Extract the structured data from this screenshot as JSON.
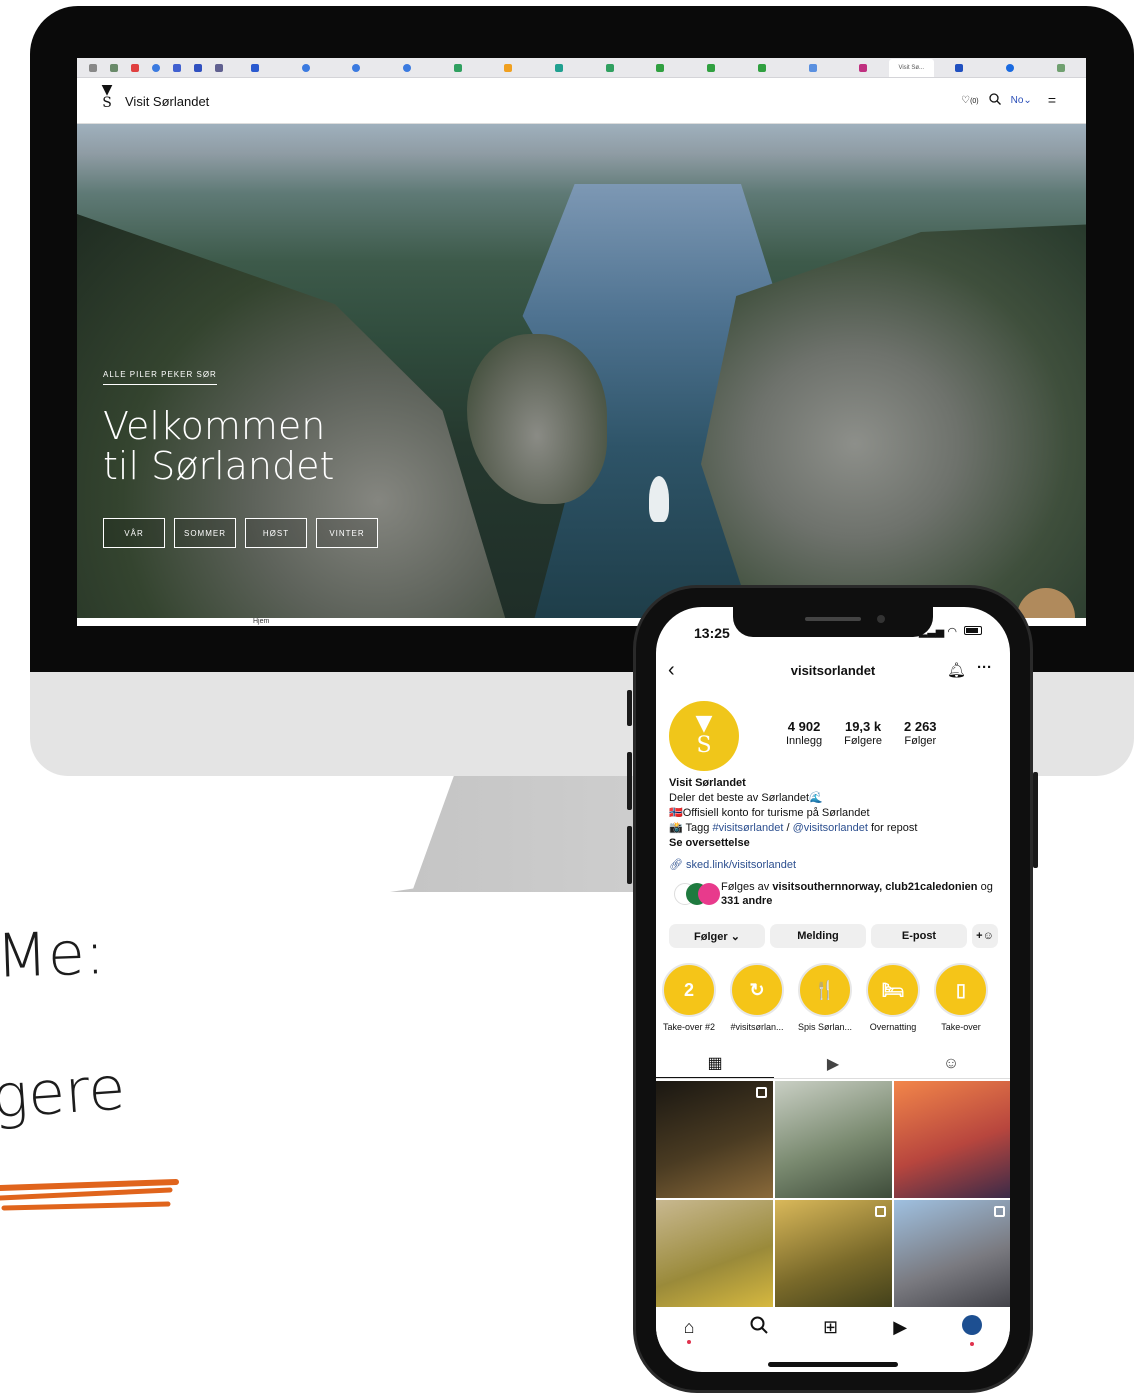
{
  "desktop": {
    "browser_tabs": {
      "active_tab_label": "Visit Sø..."
    },
    "site": {
      "logo_text": "V\nS",
      "name": "Visit Sørlandet",
      "wishlist_count": "(0)",
      "language": "No",
      "footer_text": "Hjem"
    },
    "hero": {
      "eyebrow": "ALLE PILER PEKER SØR",
      "title_line1": "Velkommen",
      "title_line2": "til Sørlandet",
      "seasons": [
        "VÅR",
        "SOMMER",
        "HØST",
        "VINTER"
      ]
    }
  },
  "handwriting": {
    "line1": "Me:",
    "line2": "gere",
    "underline_color": "#e0641c"
  },
  "phone": {
    "status": {
      "time": "13:25"
    },
    "instagram": {
      "username": "visitsorlandet",
      "stats": [
        {
          "value": "4 902",
          "label": "Innlegg"
        },
        {
          "value": "19,3 k",
          "label": "Følgere"
        },
        {
          "value": "2 263",
          "label": "Følger"
        }
      ],
      "bio": {
        "name": "Visit Sørlandet",
        "line1": "Deler det beste av Sørlandet🌊",
        "line2": "🇳🇴Offisiell konto for turisme på Sørlandet",
        "line3_prefix": "📸 Tagg ",
        "line3_tag1": "#visitsørlandet",
        "line3_sep": " / ",
        "line3_tag2": "@visitsorlandet",
        "line3_suffix": " for repost",
        "translate": "Se oversettelse"
      },
      "link": "sked.link/visitsorlandet",
      "followed_by": {
        "prefix": "Følges av ",
        "names": "visitsouthernnorway, club21caledonien",
        "suffix_mid": " og ",
        "others": "331 andre"
      },
      "actions": {
        "following": "Følger ⌄",
        "message": "Melding",
        "email": "E-post",
        "add_person": "+🯅"
      },
      "highlights": [
        {
          "label": "Take-over #2",
          "glyph": "2"
        },
        {
          "label": "#visitsørlan...",
          "glyph": "↻"
        },
        {
          "label": "Spis Sørlan...",
          "glyph": "🍴"
        },
        {
          "label": "Overnatting",
          "glyph": "🛏"
        },
        {
          "label": "Take-over",
          "glyph": "▯"
        }
      ],
      "tabs": [
        "grid-icon",
        "reels-icon",
        "tagged-icon"
      ],
      "posts": [
        {
          "theme": "night city church",
          "colors": [
            "#1a1712",
            "#4a3b22",
            "#8a6a3a"
          ]
        },
        {
          "theme": "rowboat on lake",
          "colors": [
            "#c9cfc4",
            "#7a8a70",
            "#3e4c3a"
          ]
        },
        {
          "theme": "sunset fjord",
          "colors": [
            "#f2864a",
            "#b8463e",
            "#3a2a48"
          ]
        },
        {
          "theme": "yellow flowers",
          "colors": [
            "#c8b890",
            "#9a8a3a",
            "#e0c040"
          ]
        },
        {
          "theme": "forest hiker with dog",
          "colors": [
            "#d9b85a",
            "#7a6a2a",
            "#3a3a18"
          ]
        },
        {
          "theme": "mining tower",
          "colors": [
            "#9fc0e0",
            "#7a7a80",
            "#3a3a40"
          ]
        }
      ]
    }
  },
  "colors": {
    "brand_yellow": "#f5c518",
    "link_blue": "#2c4f8f",
    "accent_orange": "#e0641c"
  }
}
